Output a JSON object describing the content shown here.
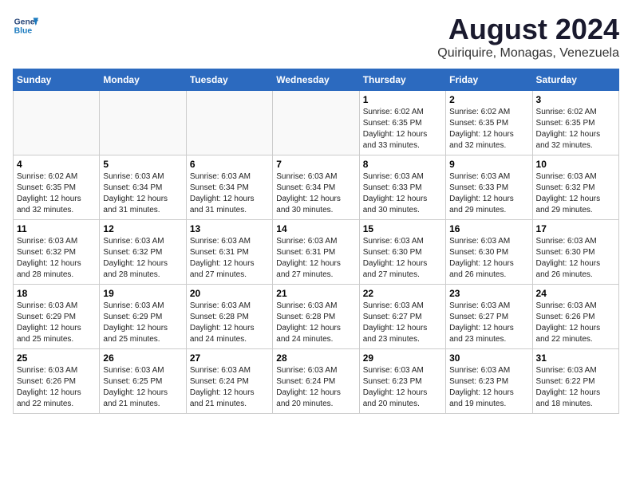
{
  "logo": {
    "line1": "General",
    "line2": "Blue"
  },
  "title": "August 2024",
  "location": "Quiriquire, Monagas, Venezuela",
  "days_header": [
    "Sunday",
    "Monday",
    "Tuesday",
    "Wednesday",
    "Thursday",
    "Friday",
    "Saturday"
  ],
  "weeks": [
    [
      {
        "day": "",
        "info": ""
      },
      {
        "day": "",
        "info": ""
      },
      {
        "day": "",
        "info": ""
      },
      {
        "day": "",
        "info": ""
      },
      {
        "day": "1",
        "info": "Sunrise: 6:02 AM\nSunset: 6:35 PM\nDaylight: 12 hours\nand 33 minutes."
      },
      {
        "day": "2",
        "info": "Sunrise: 6:02 AM\nSunset: 6:35 PM\nDaylight: 12 hours\nand 32 minutes."
      },
      {
        "day": "3",
        "info": "Sunrise: 6:02 AM\nSunset: 6:35 PM\nDaylight: 12 hours\nand 32 minutes."
      }
    ],
    [
      {
        "day": "4",
        "info": "Sunrise: 6:02 AM\nSunset: 6:35 PM\nDaylight: 12 hours\nand 32 minutes."
      },
      {
        "day": "5",
        "info": "Sunrise: 6:03 AM\nSunset: 6:34 PM\nDaylight: 12 hours\nand 31 minutes."
      },
      {
        "day": "6",
        "info": "Sunrise: 6:03 AM\nSunset: 6:34 PM\nDaylight: 12 hours\nand 31 minutes."
      },
      {
        "day": "7",
        "info": "Sunrise: 6:03 AM\nSunset: 6:34 PM\nDaylight: 12 hours\nand 30 minutes."
      },
      {
        "day": "8",
        "info": "Sunrise: 6:03 AM\nSunset: 6:33 PM\nDaylight: 12 hours\nand 30 minutes."
      },
      {
        "day": "9",
        "info": "Sunrise: 6:03 AM\nSunset: 6:33 PM\nDaylight: 12 hours\nand 29 minutes."
      },
      {
        "day": "10",
        "info": "Sunrise: 6:03 AM\nSunset: 6:32 PM\nDaylight: 12 hours\nand 29 minutes."
      }
    ],
    [
      {
        "day": "11",
        "info": "Sunrise: 6:03 AM\nSunset: 6:32 PM\nDaylight: 12 hours\nand 28 minutes."
      },
      {
        "day": "12",
        "info": "Sunrise: 6:03 AM\nSunset: 6:32 PM\nDaylight: 12 hours\nand 28 minutes."
      },
      {
        "day": "13",
        "info": "Sunrise: 6:03 AM\nSunset: 6:31 PM\nDaylight: 12 hours\nand 27 minutes."
      },
      {
        "day": "14",
        "info": "Sunrise: 6:03 AM\nSunset: 6:31 PM\nDaylight: 12 hours\nand 27 minutes."
      },
      {
        "day": "15",
        "info": "Sunrise: 6:03 AM\nSunset: 6:30 PM\nDaylight: 12 hours\nand 27 minutes."
      },
      {
        "day": "16",
        "info": "Sunrise: 6:03 AM\nSunset: 6:30 PM\nDaylight: 12 hours\nand 26 minutes."
      },
      {
        "day": "17",
        "info": "Sunrise: 6:03 AM\nSunset: 6:30 PM\nDaylight: 12 hours\nand 26 minutes."
      }
    ],
    [
      {
        "day": "18",
        "info": "Sunrise: 6:03 AM\nSunset: 6:29 PM\nDaylight: 12 hours\nand 25 minutes."
      },
      {
        "day": "19",
        "info": "Sunrise: 6:03 AM\nSunset: 6:29 PM\nDaylight: 12 hours\nand 25 minutes."
      },
      {
        "day": "20",
        "info": "Sunrise: 6:03 AM\nSunset: 6:28 PM\nDaylight: 12 hours\nand 24 minutes."
      },
      {
        "day": "21",
        "info": "Sunrise: 6:03 AM\nSunset: 6:28 PM\nDaylight: 12 hours\nand 24 minutes."
      },
      {
        "day": "22",
        "info": "Sunrise: 6:03 AM\nSunset: 6:27 PM\nDaylight: 12 hours\nand 23 minutes."
      },
      {
        "day": "23",
        "info": "Sunrise: 6:03 AM\nSunset: 6:27 PM\nDaylight: 12 hours\nand 23 minutes."
      },
      {
        "day": "24",
        "info": "Sunrise: 6:03 AM\nSunset: 6:26 PM\nDaylight: 12 hours\nand 22 minutes."
      }
    ],
    [
      {
        "day": "25",
        "info": "Sunrise: 6:03 AM\nSunset: 6:26 PM\nDaylight: 12 hours\nand 22 minutes."
      },
      {
        "day": "26",
        "info": "Sunrise: 6:03 AM\nSunset: 6:25 PM\nDaylight: 12 hours\nand 21 minutes."
      },
      {
        "day": "27",
        "info": "Sunrise: 6:03 AM\nSunset: 6:24 PM\nDaylight: 12 hours\nand 21 minutes."
      },
      {
        "day": "28",
        "info": "Sunrise: 6:03 AM\nSunset: 6:24 PM\nDaylight: 12 hours\nand 20 minutes."
      },
      {
        "day": "29",
        "info": "Sunrise: 6:03 AM\nSunset: 6:23 PM\nDaylight: 12 hours\nand 20 minutes."
      },
      {
        "day": "30",
        "info": "Sunrise: 6:03 AM\nSunset: 6:23 PM\nDaylight: 12 hours\nand 19 minutes."
      },
      {
        "day": "31",
        "info": "Sunrise: 6:03 AM\nSunset: 6:22 PM\nDaylight: 12 hours\nand 18 minutes."
      }
    ]
  ]
}
